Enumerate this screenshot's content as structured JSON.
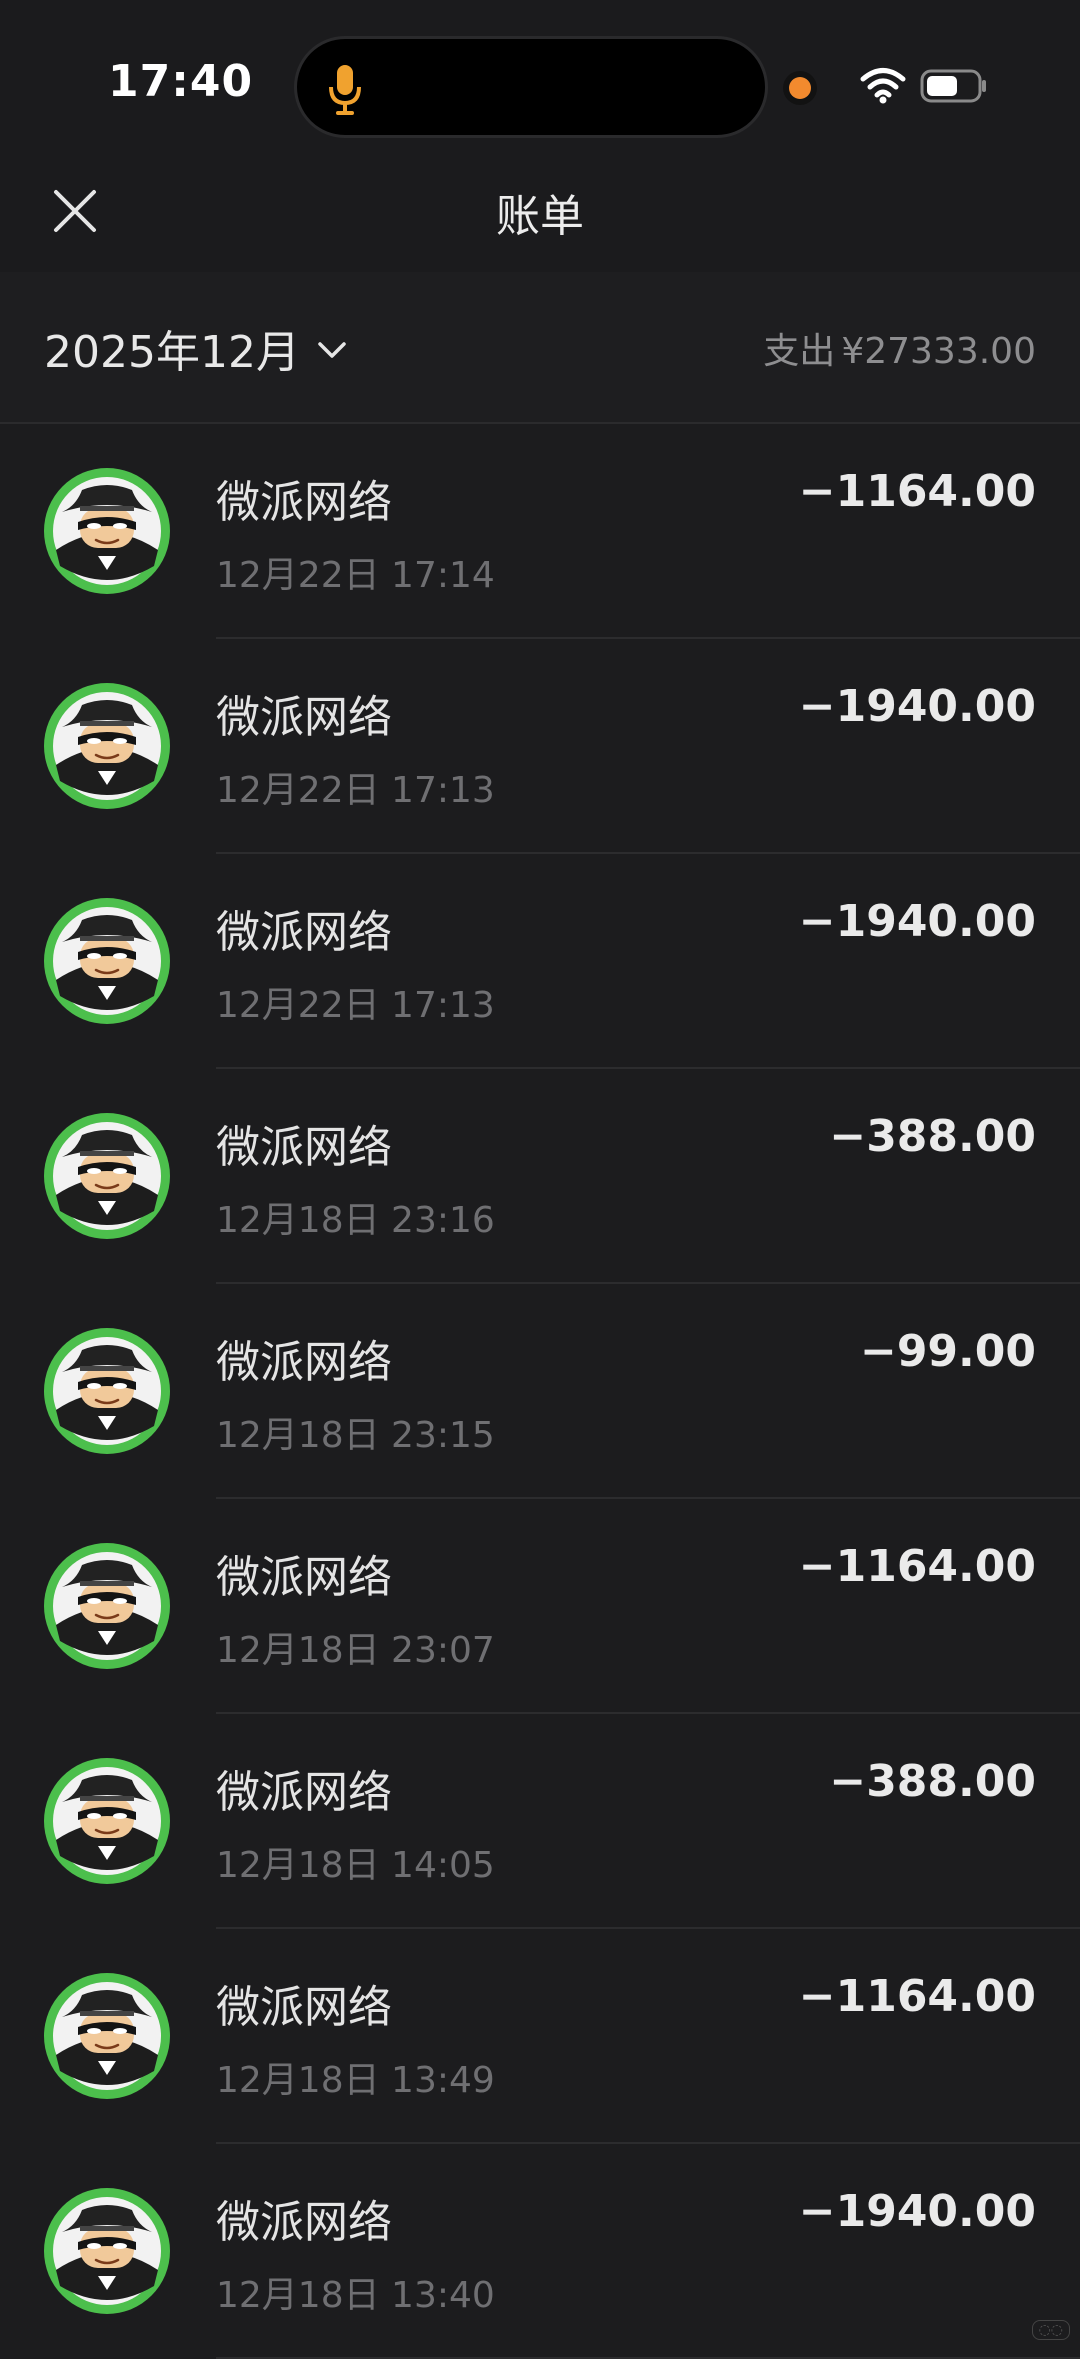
{
  "status_bar": {
    "time": "17:40",
    "icons": [
      "mic-icon",
      "camera-dot",
      "wifi-icon",
      "battery-icon"
    ],
    "mic_color": "#f0a22f",
    "camera_dot_color": "#f28a2e"
  },
  "nav": {
    "title": "账单",
    "close_icon": "close-icon"
  },
  "filter": {
    "month": "2025年12月",
    "summary_label": "支出",
    "summary_amount": "¥27333.00"
  },
  "transactions": [
    {
      "merchant": "微派网络",
      "date": "12月22日 17:14",
      "amount": "−1164.00"
    },
    {
      "merchant": "微派网络",
      "date": "12月22日 17:13",
      "amount": "−1940.00"
    },
    {
      "merchant": "微派网络",
      "date": "12月22日 17:13",
      "amount": "−1940.00"
    },
    {
      "merchant": "微派网络",
      "date": "12月18日 23:16",
      "amount": "−388.00"
    },
    {
      "merchant": "微派网络",
      "date": "12月18日 23:15",
      "amount": "−99.00"
    },
    {
      "merchant": "微派网络",
      "date": "12月18日 23:07",
      "amount": "−1164.00"
    },
    {
      "merchant": "微派网络",
      "date": "12月18日 14:05",
      "amount": "−388.00"
    },
    {
      "merchant": "微派网络",
      "date": "12月18日 13:49",
      "amount": "−1164.00"
    },
    {
      "merchant": "微派网络",
      "date": "12月18日 13:40",
      "amount": "−1940.00"
    }
  ],
  "colors": {
    "background": "#1c1c1e",
    "avatar_ring": "#4cbf4c",
    "secondary_text": "#6f6f72"
  }
}
